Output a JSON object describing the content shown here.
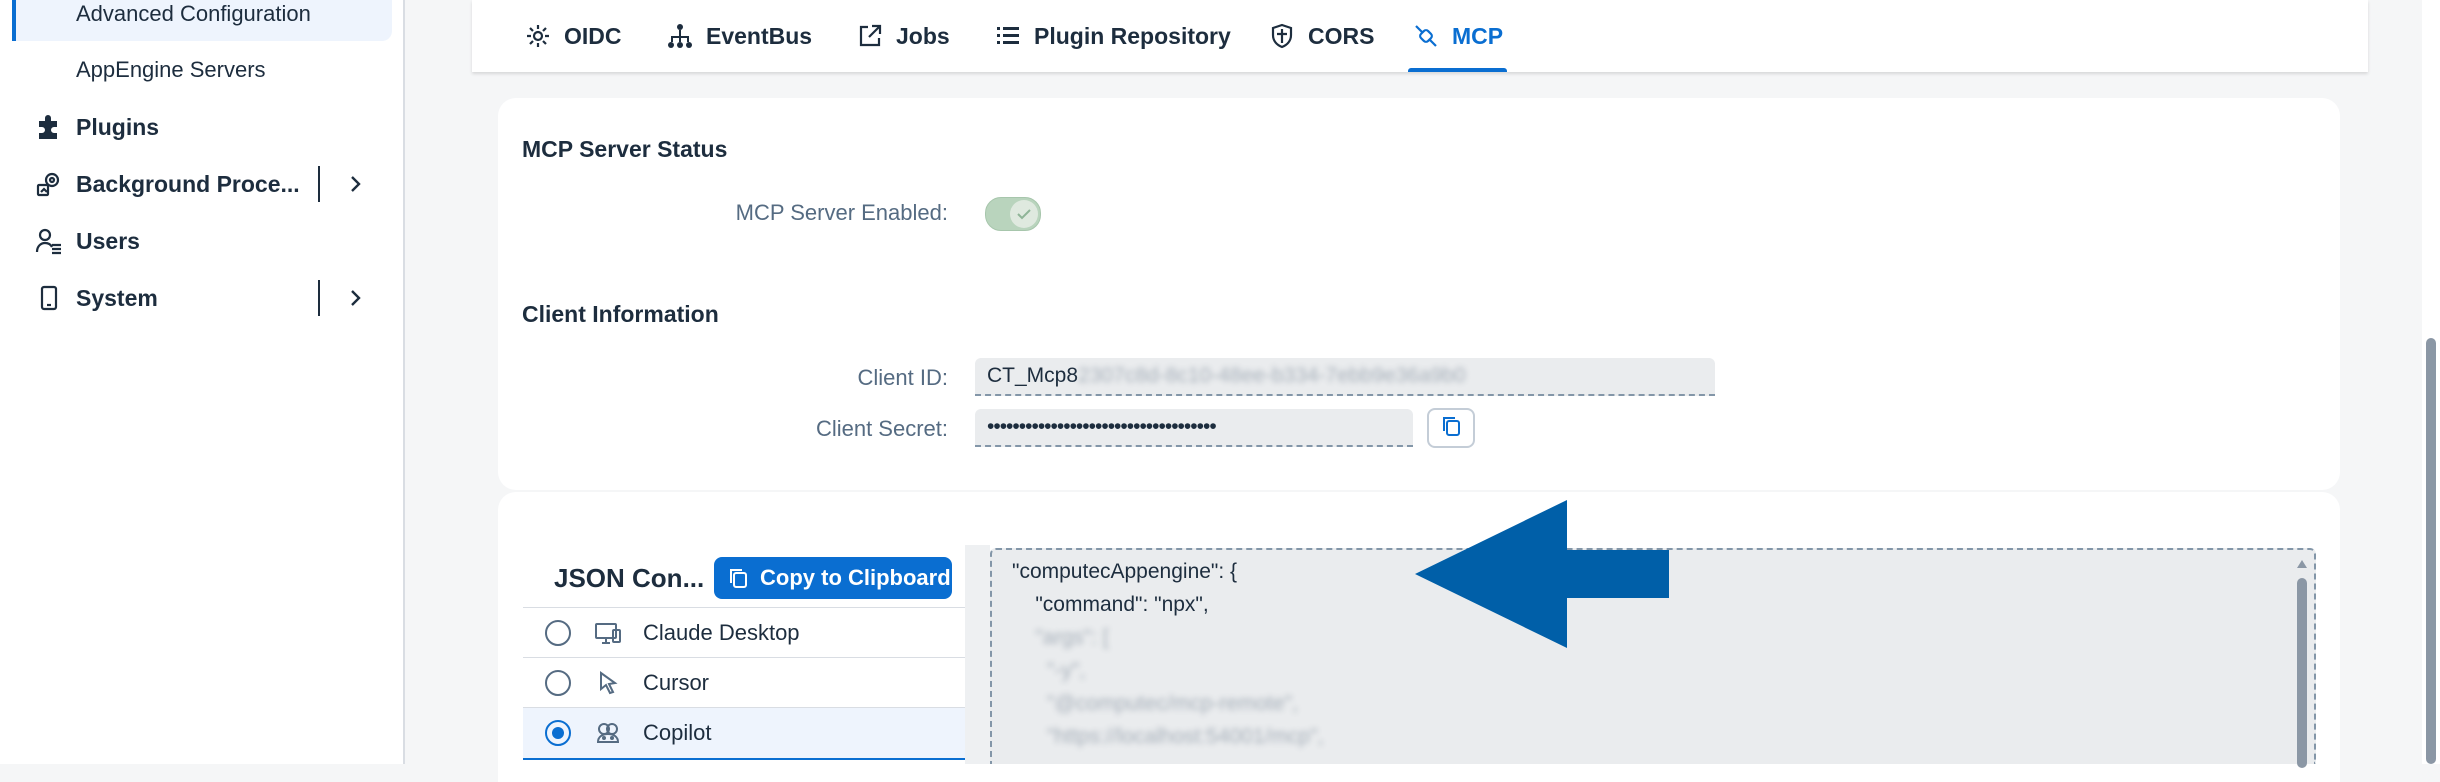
{
  "sidebar": {
    "items": [
      {
        "label": "Advanced Configuration",
        "kind": "child",
        "selected": true
      },
      {
        "label": "AppEngine Servers",
        "kind": "child"
      },
      {
        "label": "Plugins",
        "kind": "parent",
        "icon": "plugin-icon"
      },
      {
        "label": "Background Proce...",
        "kind": "parent",
        "icon": "background-process-icon",
        "expandable": true
      },
      {
        "label": "Users",
        "kind": "parent",
        "icon": "users-icon"
      },
      {
        "label": "System",
        "kind": "parent",
        "icon": "system-icon",
        "expandable": true
      }
    ]
  },
  "tabs": [
    {
      "label": "OIDC",
      "icon": "gear-icon"
    },
    {
      "label": "EventBus",
      "icon": "hierarchy-icon"
    },
    {
      "label": "Jobs",
      "icon": "share-icon"
    },
    {
      "label": "Plugin Repository",
      "icon": "list-icon"
    },
    {
      "label": "CORS",
      "icon": "shield-icon"
    },
    {
      "label": "MCP",
      "icon": "connector-icon",
      "active": true
    }
  ],
  "mcp_status": {
    "title": "MCP Server Status",
    "enabled_label": "MCP Server Enabled:",
    "enabled": true
  },
  "client_info": {
    "title": "Client Information",
    "client_id_label": "Client ID:",
    "client_id_value": "CT_Mcp8",
    "client_id_obscured": "2307c8d-8c10-48ee-b334-7ebb9e36a9b0",
    "client_secret_label": "Client Secret:",
    "client_secret_value": "••••••••••••••••••••••••••••••••••••"
  },
  "json_config": {
    "title": "JSON Con...",
    "copy_label": "Copy to Clipboard",
    "clients": [
      {
        "label": "Claude Desktop",
        "icon": "desktop-icon",
        "selected": false
      },
      {
        "label": "Cursor",
        "icon": "cursor-icon",
        "selected": false
      },
      {
        "label": "Copilot",
        "icon": "copilot-icon",
        "selected": true
      }
    ],
    "code_lines": [
      {
        "text": "\"computecAppengine\": {",
        "blurred": false
      },
      {
        "text": "    \"command\": \"npx\",",
        "blurred": false
      },
      {
        "text": "    \"args\": [",
        "blurred": true
      },
      {
        "text": "      \"-y\",",
        "blurred": true
      },
      {
        "text": "      \"@computec/mcp-remote\",",
        "blurred": true
      },
      {
        "text": "      \"https://localhost:54001/mcp\",",
        "blurred": true
      }
    ]
  },
  "colors": {
    "accent": "#0a6ed1",
    "annotation_arrow": "#005fa8",
    "toggle_on": "#b9d4bd"
  }
}
